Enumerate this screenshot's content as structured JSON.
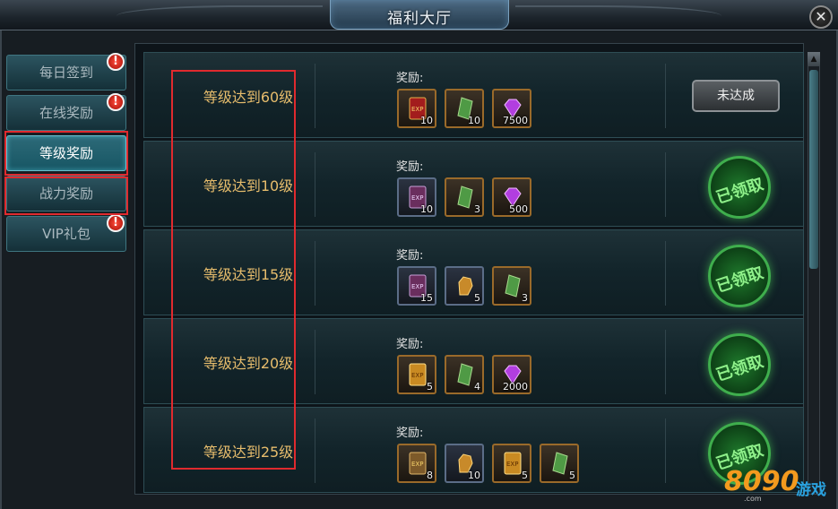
{
  "window": {
    "title": "福利大厅"
  },
  "tabs": [
    {
      "label": "每日签到",
      "badge": "!"
    },
    {
      "label": "在线奖励",
      "badge": "!"
    },
    {
      "label": "等级奖励",
      "active": true
    },
    {
      "label": "战力奖励"
    },
    {
      "label": "VIP礼包",
      "badge": "!"
    }
  ],
  "reward_label": "奖励:",
  "rows": [
    {
      "title": "等级达到60级",
      "items": [
        {
          "icon": "exp-card-icon",
          "count": "10"
        },
        {
          "icon": "green-talisman-icon",
          "count": "10"
        },
        {
          "icon": "purple-gem-icon",
          "count": "7500"
        }
      ],
      "status": "未达成"
    },
    {
      "title": "等级达到10级",
      "items": [
        {
          "icon": "exp-card-icon",
          "count": "10"
        },
        {
          "icon": "green-talisman-icon",
          "count": "3"
        },
        {
          "icon": "purple-gem-icon",
          "count": "500"
        }
      ],
      "status": "已领取"
    },
    {
      "title": "等级达到15级",
      "items": [
        {
          "icon": "exp-card-icon",
          "count": "15"
        },
        {
          "icon": "gold-gauntlet-icon",
          "count": "5"
        },
        {
          "icon": "green-talisman-icon",
          "count": "3"
        }
      ],
      "status": "已领取"
    },
    {
      "title": "等级达到20级",
      "items": [
        {
          "icon": "exp-card-icon",
          "count": "5"
        },
        {
          "icon": "green-talisman-icon",
          "count": "4"
        },
        {
          "icon": "purple-gem-icon",
          "count": "2000"
        }
      ],
      "status": "已领取"
    },
    {
      "title": "等级达到25级",
      "items": [
        {
          "icon": "exp-card-icon",
          "count": "8"
        },
        {
          "icon": "gold-gauntlet-icon",
          "count": "10"
        },
        {
          "icon": "exp-card-icon",
          "count": "5"
        },
        {
          "icon": "green-talisman-icon",
          "count": "5"
        }
      ],
      "status": "已领取"
    }
  ],
  "close_glyph": "✕",
  "scroll_up_glyph": "▲",
  "watermark": {
    "brand": "8090",
    "text": "游戏",
    "domain": ".com"
  }
}
